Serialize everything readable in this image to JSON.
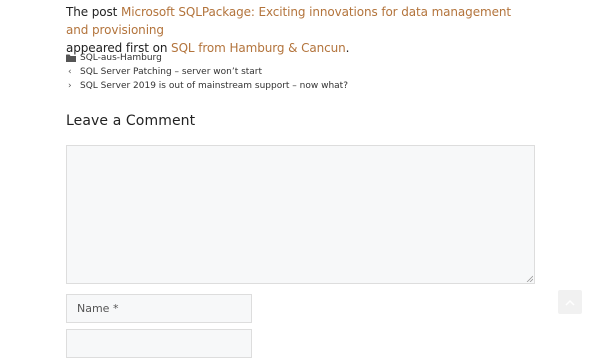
{
  "post": {
    "prefix": "The post ",
    "post_link": "Microsoft SQLPackage: Exciting innovations for data management and provisioning",
    "middle": " appeared first on ",
    "site_link": "SQL from Hamburg & Cancun",
    "suffix": "."
  },
  "meta": {
    "category": "SQL-aus-Hamburg",
    "prev_post": "SQL Server Patching – server won’t start",
    "next_post": "SQL Server 2019 is out of mainstream support – now what?"
  },
  "comments": {
    "title": "Leave a Comment",
    "comment_value": "",
    "name_placeholder": "Name *"
  },
  "colors": {
    "link": "#b3743c",
    "field_bg": "#f7f8f9",
    "field_border": "#dddddd"
  },
  "icons": {
    "category": "folder-icon",
    "prev": "chevron-left-icon",
    "next": "chevron-right-icon",
    "back_to_top": "chevron-up-icon"
  }
}
